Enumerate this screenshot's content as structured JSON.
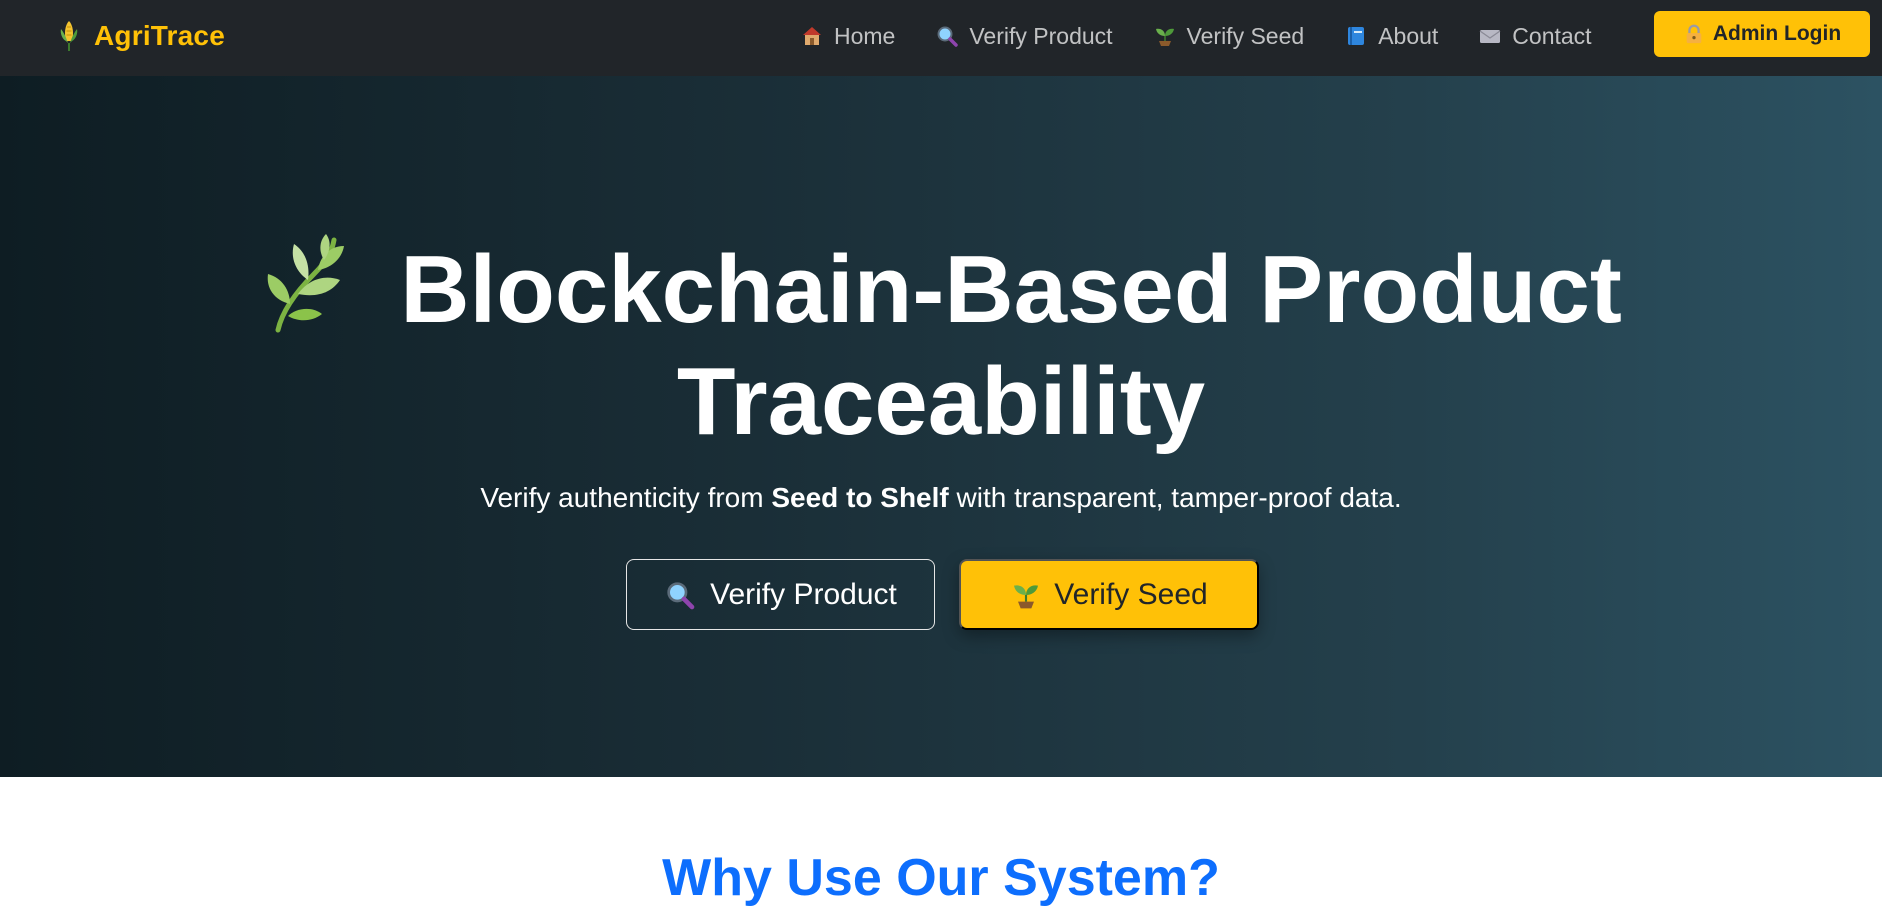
{
  "navbar": {
    "brand": {
      "icon": "corn-icon",
      "label": "AgriTrace"
    },
    "links": [
      {
        "icon": "house-icon",
        "label": "Home"
      },
      {
        "icon": "magnifier-icon",
        "label": "Verify Product"
      },
      {
        "icon": "seedling-icon",
        "label": "Verify Seed"
      },
      {
        "icon": "book-icon",
        "label": "About"
      },
      {
        "icon": "envelope-icon",
        "label": "Contact"
      }
    ],
    "admin_button": {
      "icon": "lock-icon",
      "label": "Admin Login"
    }
  },
  "hero": {
    "title_line1": "Blockchain-Based Product",
    "title_line2": "Traceability",
    "title_icon": "herb-icon",
    "subtitle_before": "Verify authenticity from ",
    "subtitle_bold": "Seed to Shelf",
    "subtitle_after": " with transparent, tamper-proof data.",
    "buttons": [
      {
        "icon": "magnifier-icon",
        "label": "Verify Product"
      },
      {
        "icon": "seedling-icon",
        "label": "Verify Seed"
      }
    ]
  },
  "next_section": {
    "title": "Why Use Our System?"
  },
  "colors": {
    "navbar_bg": "#212529",
    "accent_yellow": "#ffc107",
    "hero_gradient_start": "#0e1d23",
    "hero_gradient_end": "#2c5262",
    "section_title_blue": "#0d6efd"
  }
}
